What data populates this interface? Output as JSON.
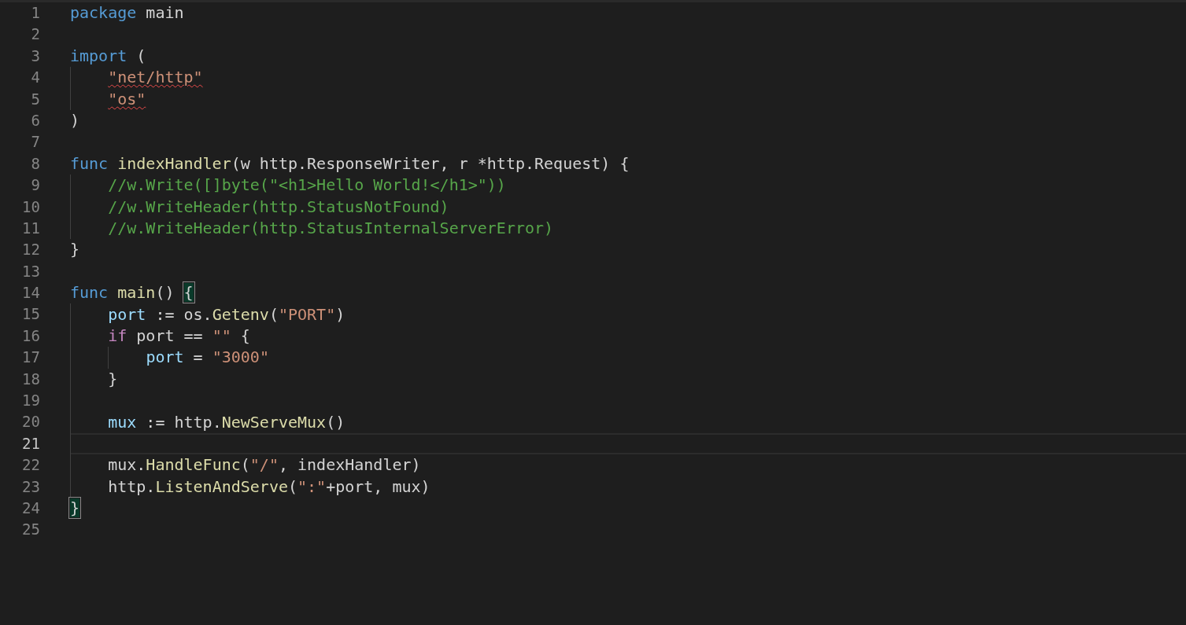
{
  "editor": {
    "lines": [
      {
        "number": "1",
        "current": false,
        "tokens": [
          {
            "kind": "keyword",
            "text": "package",
            "error": false,
            "matched": false
          },
          {
            "kind": "plain",
            "text": " main",
            "error": false,
            "matched": false
          }
        ]
      },
      {
        "number": "2",
        "current": false
      },
      {
        "number": "3",
        "current": false,
        "tokens": [
          {
            "kind": "keyword",
            "text": "import",
            "error": false,
            "matched": false
          },
          {
            "kind": "plain",
            "text": " (",
            "error": false,
            "matched": false
          }
        ],
        "children": [
          {
            "number": "4",
            "current": false,
            "tokens": [
              {
                "kind": "string",
                "text": "\"net/http\"",
                "error": true,
                "matched": false
              }
            ]
          },
          {
            "number": "5",
            "current": false,
            "tokens": [
              {
                "kind": "string",
                "text": "\"os\"",
                "error": true,
                "matched": false
              }
            ]
          }
        ]
      },
      {
        "number": "6",
        "current": false,
        "tokens": [
          {
            "kind": "plain",
            "text": ")",
            "error": false,
            "matched": false
          }
        ]
      },
      {
        "number": "7",
        "current": false
      },
      {
        "number": "8",
        "current": false,
        "tokens": [
          {
            "kind": "keyword",
            "text": "func",
            "error": false,
            "matched": false
          },
          {
            "kind": "func",
            "text": " indexHandler",
            "error": false,
            "matched": false
          },
          {
            "kind": "plain",
            "text": "(w http.ResponseWriter, r *http.Request) {",
            "error": false,
            "matched": false
          }
        ],
        "children": [
          {
            "number": "9",
            "current": false,
            "tokens": [
              {
                "kind": "comment",
                "text": "//w.Write([]byte(\"<h1>Hello World!</h1>\"))",
                "error": false,
                "matched": false
              }
            ]
          },
          {
            "number": "10",
            "current": false,
            "tokens": [
              {
                "kind": "comment",
                "text": "//w.WriteHeader(http.StatusNotFound)",
                "error": false,
                "matched": false
              }
            ]
          },
          {
            "number": "11",
            "current": false,
            "tokens": [
              {
                "kind": "comment",
                "text": "//w.WriteHeader(http.StatusInternalServerError)",
                "error": false,
                "matched": false
              }
            ]
          }
        ]
      },
      {
        "number": "12",
        "current": false,
        "tokens": [
          {
            "kind": "plain",
            "text": "}",
            "error": false,
            "matched": false
          }
        ]
      },
      {
        "number": "13",
        "current": false
      },
      {
        "number": "14",
        "current": false,
        "tokens": [
          {
            "kind": "keyword",
            "text": "func",
            "error": false,
            "matched": false
          },
          {
            "kind": "func",
            "text": " main",
            "error": false,
            "matched": false
          },
          {
            "kind": "plain",
            "text": "() ",
            "error": false,
            "matched": false
          },
          {
            "kind": "plain",
            "text": "{",
            "error": false,
            "matched": true
          }
        ],
        "children": [
          {
            "number": "15",
            "current": false,
            "tokens": [
              {
                "kind": "var",
                "text": "port",
                "error": false,
                "matched": false
              },
              {
                "kind": "plain",
                "text": " := os.",
                "error": false,
                "matched": false
              },
              {
                "kind": "func",
                "text": "Getenv",
                "error": false,
                "matched": false
              },
              {
                "kind": "plain",
                "text": "(",
                "error": false,
                "matched": false
              },
              {
                "kind": "string",
                "text": "\"PORT\"",
                "error": false,
                "matched": false
              },
              {
                "kind": "plain",
                "text": ")",
                "error": false,
                "matched": false
              }
            ]
          },
          {
            "number": "16",
            "current": false,
            "tokens": [
              {
                "kind": "control",
                "text": "if",
                "error": false,
                "matched": false
              },
              {
                "kind": "plain",
                "text": " port == ",
                "error": false,
                "matched": false
              },
              {
                "kind": "string",
                "text": "\"\"",
                "error": false,
                "matched": false
              },
              {
                "kind": "plain",
                "text": " {",
                "error": false,
                "matched": false
              }
            ],
            "children": [
              {
                "number": "17",
                "current": false,
                "tokens": [
                  {
                    "kind": "var",
                    "text": "port",
                    "error": false,
                    "matched": false
                  },
                  {
                    "kind": "plain",
                    "text": " = ",
                    "error": false,
                    "matched": false
                  },
                  {
                    "kind": "string",
                    "text": "\"3000\"",
                    "error": false,
                    "matched": false
                  }
                ]
              }
            ]
          },
          {
            "number": "18",
            "current": false,
            "tokens": [
              {
                "kind": "plain",
                "text": "}",
                "error": false,
                "matched": false
              }
            ]
          },
          {
            "number": "19",
            "current": false
          },
          {
            "number": "20",
            "current": false,
            "tokens": [
              {
                "kind": "var",
                "text": "mux",
                "error": false,
                "matched": false
              },
              {
                "kind": "plain",
                "text": " := http.",
                "error": false,
                "matched": false
              },
              {
                "kind": "func",
                "text": "NewServeMux",
                "error": false,
                "matched": false
              },
              {
                "kind": "plain",
                "text": "()",
                "error": false,
                "matched": false
              }
            ]
          },
          {
            "number": "21",
            "current": true
          },
          {
            "number": "22",
            "current": false,
            "tokens": [
              {
                "kind": "plain",
                "text": "mux.",
                "error": false,
                "matched": false
              },
              {
                "kind": "func",
                "text": "HandleFunc",
                "error": false,
                "matched": false
              },
              {
                "kind": "plain",
                "text": "(",
                "error": false,
                "matched": false
              },
              {
                "kind": "string",
                "text": "\"/\"",
                "error": false,
                "matched": false
              },
              {
                "kind": "plain",
                "text": ", indexHandler)",
                "error": false,
                "matched": false
              }
            ]
          },
          {
            "number": "23",
            "current": false,
            "tokens": [
              {
                "kind": "plain",
                "text": "http.",
                "error": false,
                "matched": false
              },
              {
                "kind": "func",
                "text": "ListenAndServe",
                "error": false,
                "matched": false
              },
              {
                "kind": "plain",
                "text": "(",
                "error": false,
                "matched": false
              },
              {
                "kind": "string",
                "text": "\":\"",
                "error": false,
                "matched": false
              },
              {
                "kind": "plain",
                "text": "+port, mux)",
                "error": false,
                "matched": false
              }
            ]
          }
        ]
      },
      {
        "number": "24",
        "current": false,
        "tokens": [
          {
            "kind": "plain",
            "text": "}",
            "error": false,
            "matched": true
          }
        ]
      },
      {
        "number": "25",
        "current": false
      }
    ]
  }
}
